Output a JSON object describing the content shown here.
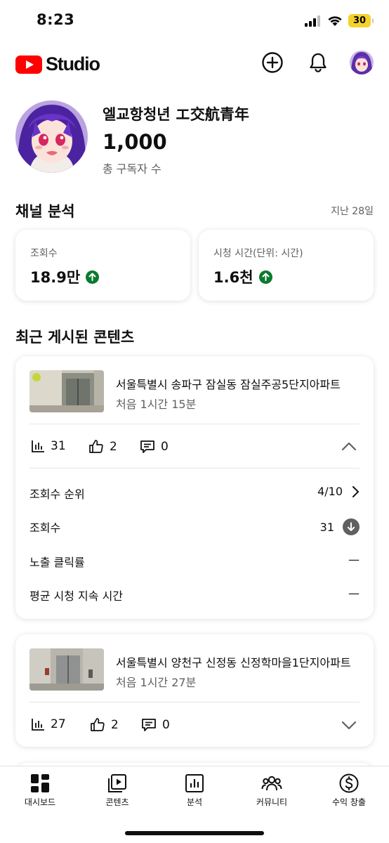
{
  "status_bar": {
    "time": "8:23",
    "battery": "30"
  },
  "header": {
    "logo_text": "Studio",
    "create_icon": "plus-circle-icon",
    "notification_icon": "bell-icon",
    "colors": {
      "brand": "#ff0000"
    }
  },
  "channel": {
    "name": "엘교항청년 エ交航青年",
    "subscriber_count": "1,000",
    "subscriber_label": "총 구독자 수"
  },
  "analytics": {
    "title": "채널 분석",
    "period": "지난 28일",
    "cards": [
      {
        "label": "조회수",
        "value": "18.9만",
        "trend": "up"
      },
      {
        "label": "시청 시간(단위: 시간)",
        "value": "1.6천",
        "trend": "up"
      }
    ],
    "colors": {
      "trend_up": "#0b7a2e"
    }
  },
  "recent": {
    "title": "최근 게시된 콘텐츠",
    "videos": [
      {
        "title": "서울특별시 송파구 잠실동 잠실주공5단지아파트",
        "time": "처음 1시간 15분",
        "views": "31",
        "likes": "2",
        "comments": "0",
        "expanded": true,
        "details": [
          {
            "label": "조회수 순위",
            "value": "4/10"
          },
          {
            "label": "조회수",
            "value": "31"
          },
          {
            "label": "노출 클릭률",
            "value": "—"
          },
          {
            "label": "평균 시청 지속 시간",
            "value": "—"
          }
        ]
      },
      {
        "title": "서울특별시 양천구 신정동 신정학마을1단지아파트",
        "time": "처음 1시간 27분",
        "views": "27",
        "likes": "2",
        "comments": "0",
        "expanded": false
      }
    ]
  },
  "bottom_nav": [
    {
      "label": "대시보드",
      "icon": "dashboard-icon",
      "active": true
    },
    {
      "label": "콘텐츠",
      "icon": "content-icon",
      "active": false
    },
    {
      "label": "분석",
      "icon": "analytics-icon",
      "active": false
    },
    {
      "label": "커뮤니티",
      "icon": "community-icon",
      "active": false
    },
    {
      "label": "수익 창출",
      "icon": "monetization-icon",
      "active": false
    }
  ]
}
